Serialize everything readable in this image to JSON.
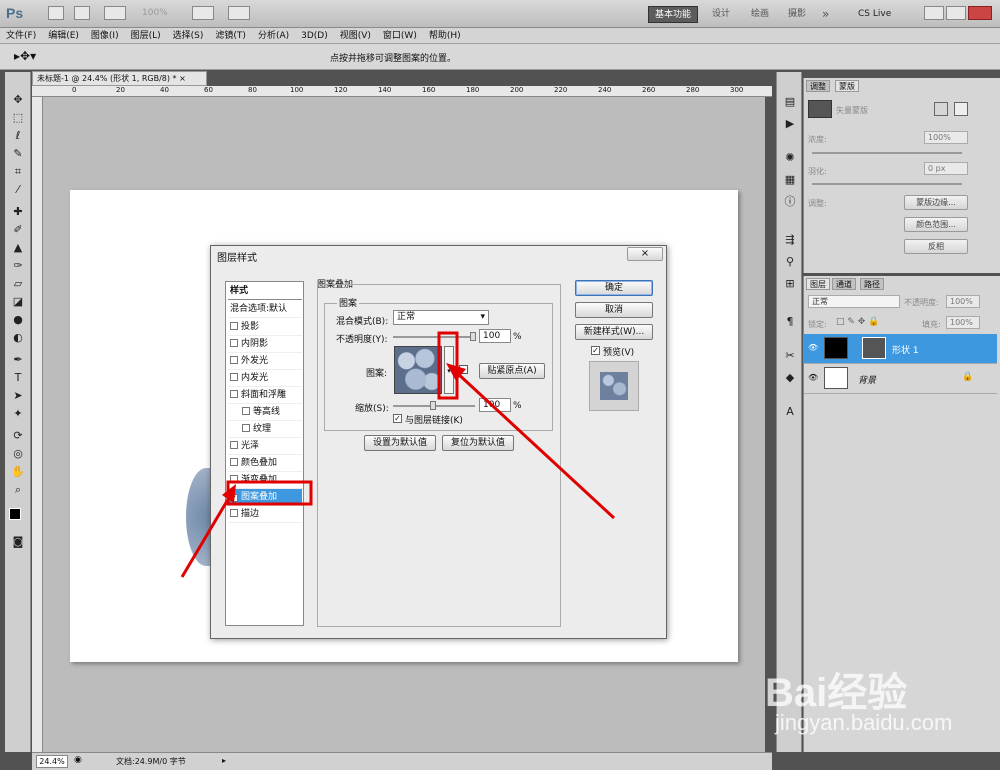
{
  "app": {
    "logo": "Ps"
  },
  "topbar": {
    "zoom": "100%",
    "workspaces": [
      "基本功能",
      "设计",
      "绘画",
      "摄影"
    ],
    "more": "»",
    "cslive": "CS Live"
  },
  "menu": [
    "文件(F)",
    "编辑(E)",
    "图像(I)",
    "图层(L)",
    "选择(S)",
    "滤镜(T)",
    "分析(A)",
    "3D(D)",
    "视图(V)",
    "窗口(W)",
    "帮助(H)"
  ],
  "options": {
    "message": "点按并拖移可调整图案的位置。"
  },
  "document": {
    "tab": "未标题-1 @ 24.4% (形状 1, RGB/8) *",
    "close": "×"
  },
  "ruler_h": [
    "0",
    "20",
    "40",
    "60",
    "80",
    "100",
    "120",
    "140",
    "160",
    "180",
    "200",
    "220",
    "240",
    "260",
    "280",
    "300",
    "320"
  ],
  "status": {
    "zoom": "24.4%",
    "info": "文档:24.9M/0 字节"
  },
  "masks": {
    "tabs": [
      "调整",
      "蒙版"
    ],
    "title": "矢量蒙版",
    "density_label": "浓度:",
    "density_value": "100%",
    "feather_label": "羽化:",
    "feather_value": "0 px",
    "adjust_label": "调整:",
    "buttons": [
      "蒙版边缘...",
      "颜色范围...",
      "反相"
    ]
  },
  "layers": {
    "tabs": [
      "图层",
      "通道",
      "路径"
    ],
    "blend": "正常",
    "opacity_label": "不透明度:",
    "opacity_value": "100%",
    "lock_label": "锁定:",
    "fill_label": "填充:",
    "fill_value": "100%",
    "items": [
      {
        "name": "形状 1",
        "selected": true
      },
      {
        "name": "背景",
        "selected": false
      }
    ]
  },
  "dialog": {
    "title": "图层样式",
    "close": "×",
    "styles_header": "样式",
    "blend_options": "混合选项:默认",
    "styles": [
      {
        "label": "投影",
        "checked": false,
        "indent": false
      },
      {
        "label": "内阴影",
        "checked": false,
        "indent": false
      },
      {
        "label": "外发光",
        "checked": false,
        "indent": false
      },
      {
        "label": "内发光",
        "checked": false,
        "indent": false
      },
      {
        "label": "斜面和浮雕",
        "checked": false,
        "indent": false
      },
      {
        "label": "等高线",
        "checked": false,
        "indent": true
      },
      {
        "label": "纹理",
        "checked": false,
        "indent": true
      },
      {
        "label": "光泽",
        "checked": false,
        "indent": false
      },
      {
        "label": "颜色叠加",
        "checked": false,
        "indent": false
      },
      {
        "label": "渐变叠加",
        "checked": false,
        "indent": false
      },
      {
        "label": "图案叠加",
        "checked": true,
        "indent": false
      },
      {
        "label": "描边",
        "checked": false,
        "indent": false
      }
    ],
    "group_title": "图案叠加",
    "subgroup_title": "图案",
    "blend_label": "混合模式(B):",
    "blend_value": "正常",
    "opacity_label": "不透明度(Y):",
    "opacity_value": "100",
    "percent": "%",
    "pattern_label": "图案:",
    "snap_button": "贴紧原点(A)",
    "scale_label": "缩放(S):",
    "scale_value": "100",
    "link_label": "与图层链接(K)",
    "set_default": "设置为默认值",
    "reset_default": "复位为默认值",
    "ok": "确定",
    "cancel": "取消",
    "new_style": "新建样式(W)...",
    "preview_label": "预览(V)"
  },
  "watermark": {
    "text": "Bai经验",
    "url": "jingyan.baidu.com"
  },
  "colors": {
    "selection": "#3d98e0",
    "annotation": "#e00000"
  }
}
